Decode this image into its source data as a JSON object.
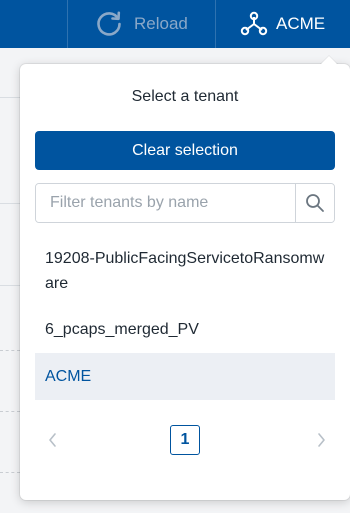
{
  "topbar": {
    "reload_label": "Reload",
    "current_tenant": "ACME",
    "bg_color": "#00549f"
  },
  "tenant_dropdown": {
    "title": "Select a tenant",
    "clear_label": "Clear selection",
    "filter_placeholder": "Filter tenants by name",
    "tenants": [
      {
        "label": "19208-PublicFacingServicetoRansomware",
        "selected": false
      },
      {
        "label": "6_pcaps_merged_PV",
        "selected": false
      },
      {
        "label": "ACME",
        "selected": true
      }
    ],
    "pagination": {
      "current_page": "1"
    }
  },
  "icons": {
    "reload": "reload-icon",
    "tenant": "tenant-network-icon",
    "search": "search-icon",
    "prev": "chevron-left-icon",
    "next": "chevron-right-icon"
  },
  "colors": {
    "primary": "#00549f",
    "selected_row_bg": "#eceff4",
    "muted_icon": "#b8c0c8"
  }
}
